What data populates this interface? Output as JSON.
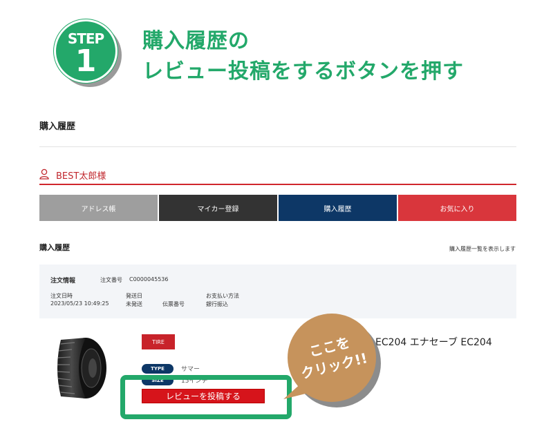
{
  "step": {
    "word": "STEP",
    "number": "1"
  },
  "headline": {
    "line1": "購入履歴の",
    "line2": "レビュー投稿をするボタンを押す"
  },
  "page_title": "購入履歴",
  "user": {
    "name": "BEST太郎様"
  },
  "nav": {
    "tabs": [
      {
        "label": "アドレス帳"
      },
      {
        "label": "マイカー登録"
      },
      {
        "label": "購入履歴"
      },
      {
        "label": "お気に入り"
      }
    ]
  },
  "section": {
    "title": "購入履歴",
    "note": "購入履歴一覧を表示します"
  },
  "order": {
    "info_label": "注文情報",
    "number_label": "注文番号",
    "number_value": "C0000045536",
    "date_label": "注文日時",
    "date_value": "2023/05/23 10:49:25",
    "ship_label": "発送日",
    "ship_value": "未発送",
    "tracking_label": "伝票番号",
    "payment_label": "お支払い方法",
    "payment_value": "銀行振込"
  },
  "product": {
    "category_tag": "TIRE",
    "name": "EC204 エナセーブ EC204",
    "type_label": "TYPE",
    "type_value": "サマー",
    "size_label": "SIZE",
    "size_value": "15インチ",
    "review_button": "レビューを投稿する"
  },
  "callout": {
    "line1": "ここを",
    "line2": "クリック!!"
  },
  "colors": {
    "brand_green": "#23a86a",
    "accent_red": "#d6141b",
    "navy": "#0d3766",
    "callout": "#c6935c"
  }
}
